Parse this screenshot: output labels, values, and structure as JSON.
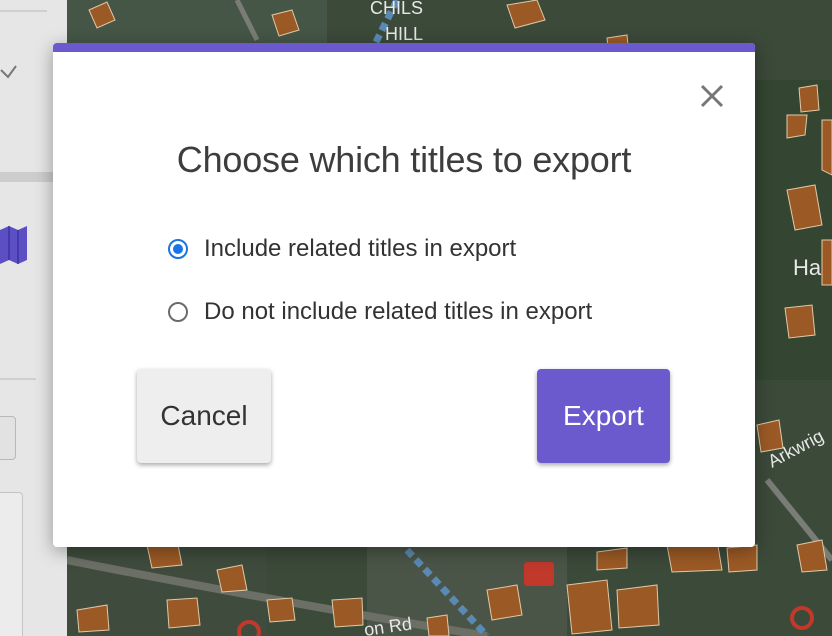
{
  "map": {
    "labels": [
      "CHILS",
      "HILL",
      "Ha",
      "Arkwrig",
      "on Rd"
    ]
  },
  "modal": {
    "title": "Choose which titles to export",
    "options": [
      {
        "label": "Include related titles in export",
        "checked": true
      },
      {
        "label": "Do not include related titles in export",
        "checked": false
      }
    ],
    "cancel_label": "Cancel",
    "export_label": "Export",
    "close_icon": "close-icon"
  },
  "colors": {
    "accent": "#6a5acd",
    "radio_selected": "#1a73e8",
    "cancel_bg": "#eeeeee",
    "overlay": "rgba(0,0,0,0.5)"
  }
}
